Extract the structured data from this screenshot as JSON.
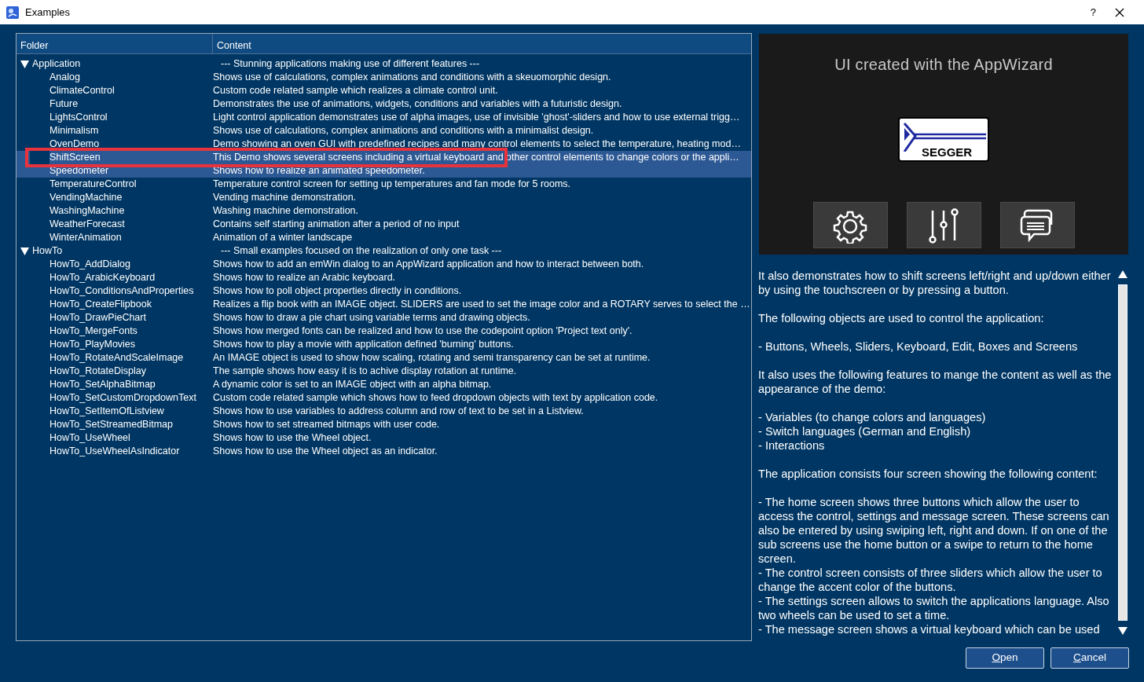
{
  "window": {
    "title": "Examples",
    "help": "?"
  },
  "table": {
    "columns": [
      "Folder",
      "Content"
    ],
    "groups": [
      {
        "name": "Application",
        "expanded": true,
        "description": "---  Stunning applications making use of different features  ---",
        "children": [
          {
            "name": "Analog",
            "content": "Shows use of calculations, complex animations and conditions with a skeuomorphic design.",
            "selected": false,
            "annotated": false
          },
          {
            "name": "ClimateControl",
            "content": "Custom code related sample which realizes a climate control unit.",
            "selected": false,
            "annotated": false
          },
          {
            "name": "Future",
            "content": "Demonstrates the use of animations, widgets, conditions and variables with a futuristic design.",
            "selected": false,
            "annotated": false
          },
          {
            "name": "LightsControl",
            "content": "Light control application demonstrates use of alpha images, use of invisible 'ghost'-sliders and how to use external trigg…",
            "selected": false,
            "annotated": false
          },
          {
            "name": "Minimalism",
            "content": "Shows use of calculations, complex animations and conditions with a minimalist design.",
            "selected": false,
            "annotated": false
          },
          {
            "name": "OvenDemo",
            "content": "Demo showing an oven GUI with predefined recipes and many control elements to select the temperature, heating mod…",
            "selected": false,
            "annotated": false
          },
          {
            "name": "ShiftScreen",
            "content": "This Demo shows several screens including a virtual keyboard and other control elements to change colors or the appli…",
            "selected": true,
            "annotated": true
          },
          {
            "name": "Speedometer",
            "content": "Shows how to realize an animated speedometer.",
            "selected": true,
            "annotated": false
          },
          {
            "name": "TemperatureControl",
            "content": "Temperature control screen for setting up temperatures and fan mode for 5 rooms.",
            "selected": false,
            "annotated": false
          },
          {
            "name": "VendingMachine",
            "content": "Vending machine demonstration.",
            "selected": false,
            "annotated": false
          },
          {
            "name": "WashingMachine",
            "content": "Washing machine demonstration.",
            "selected": false,
            "annotated": false
          },
          {
            "name": "WeatherForecast",
            "content": "Contains self starting animation after a period of no input",
            "selected": false,
            "annotated": false
          },
          {
            "name": "WinterAnimation",
            "content": "Animation of a winter landscape",
            "selected": false,
            "annotated": false
          }
        ]
      },
      {
        "name": "HowTo",
        "expanded": true,
        "description": "---  Small examples focused on the realization of only one task  ---",
        "children": [
          {
            "name": "HowTo_AddDialog",
            "content": "Shows how to add an emWin dialog to an AppWizard application and how to interact between both.",
            "selected": false,
            "annotated": false
          },
          {
            "name": "HowTo_ArabicKeyboard",
            "content": "Shows how to realize an Arabic keyboard.",
            "selected": false,
            "annotated": false
          },
          {
            "name": "HowTo_ConditionsAndProperties",
            "content": "Shows how to poll object properties directly in conditions.",
            "selected": false,
            "annotated": false
          },
          {
            "name": "HowTo_CreateFlipbook",
            "content": "Realizes a flip book with an IMAGE object. SLIDERS are used to set the image color and a ROTARY serves to select the …",
            "selected": false,
            "annotated": false
          },
          {
            "name": "HowTo_DrawPieChart",
            "content": "Shows how to draw a pie chart using variable terms and drawing objects.",
            "selected": false,
            "annotated": false
          },
          {
            "name": "HowTo_MergeFonts",
            "content": "Shows how merged fonts can be realized and how to use the codepoint option 'Project text only'.",
            "selected": false,
            "annotated": false
          },
          {
            "name": "HowTo_PlayMovies",
            "content": "Shows how to play a movie with application defined 'burning' buttons.",
            "selected": false,
            "annotated": false
          },
          {
            "name": "HowTo_RotateAndScaleImage",
            "content": "An IMAGE object is used to show how scaling, rotating and semi transparency can be set at runtime.",
            "selected": false,
            "annotated": false
          },
          {
            "name": "HowTo_RotateDisplay",
            "content": "The sample shows how easy it is to achive display rotation at runtime.",
            "selected": false,
            "annotated": false
          },
          {
            "name": "HowTo_SetAlphaBitmap",
            "content": "A dynamic color is set to an IMAGE object with an alpha bitmap.",
            "selected": false,
            "annotated": false
          },
          {
            "name": "HowTo_SetCustomDropdownText",
            "content": "Custom code related sample which shows how to feed dropdown objects with text by application code.",
            "selected": false,
            "annotated": false
          },
          {
            "name": "HowTo_SetItemOfListview",
            "content": "Shows how to use variables to address column and row of text to be set in a Listview.",
            "selected": false,
            "annotated": false
          },
          {
            "name": "HowTo_SetStreamedBitmap",
            "content": "Shows how to set streamed bitmaps with user code.",
            "selected": false,
            "annotated": false
          },
          {
            "name": "HowTo_UseWheel",
            "content": "Shows how to use the Wheel object.",
            "selected": false,
            "annotated": false
          },
          {
            "name": "HowTo_UseWheelAsIndicator",
            "content": "Shows how to use the Wheel object as an indicator.",
            "selected": false,
            "annotated": false
          }
        ]
      }
    ]
  },
  "preview": {
    "title": "UI created with the AppWizard",
    "logo": "SEGGER"
  },
  "description": {
    "paragraphs": [
      "It also demonstrates how to shift screens left/right and up/down either by using the touchscreen or by pressing a button.",
      "The following objects are used to control the application:",
      "- Buttons, Wheels, Sliders, Keyboard, Edit, Boxes and Screens",
      "It also uses the following features to mange the content as well as the appearance of the demo:",
      "- Variables (to change colors and languages)\n- Switch languages (German and English)\n- Interactions",
      "The application consists four screen showing the following content:",
      "- The home screen shows three buttons which allow the user to access the control, settings and message screen. These screens can also be entered by using swiping left, right and down. If on one of the sub screens use the home button or a swipe to return to the home screen.\n- The control screen consists of three sliders which allow the user to change the accent color of the buttons.\n- The settings screen allows to switch the applications language. Also two wheels can be used to set a time.\n- The message screen shows a virtual keyboard which can be used"
    ]
  },
  "buttons": [
    "Open",
    "Cancel"
  ]
}
